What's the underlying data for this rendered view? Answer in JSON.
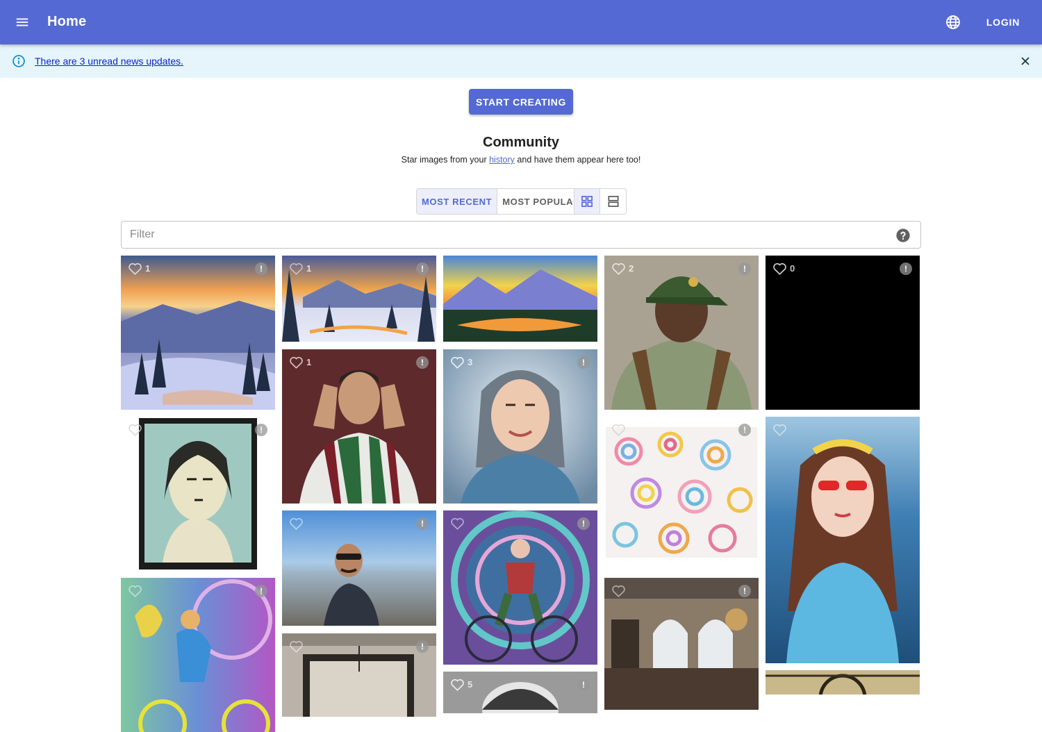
{
  "appbar": {
    "title": "Home",
    "login_label": "LOGIN"
  },
  "banner": {
    "message": "There are 3 unread news updates."
  },
  "hero": {
    "start_label": "START CREATING"
  },
  "community": {
    "title": "Community",
    "subtitle_before": "Star images from your ",
    "subtitle_link": "history",
    "subtitle_after": " and have them appear here too!"
  },
  "sort": {
    "recent_label": "MOST RECENT",
    "popular_label": "MOST POPULAR"
  },
  "filter": {
    "placeholder": "Filter"
  },
  "tiles": [
    {
      "name": "tile-winter-sunset",
      "likes": "1"
    },
    {
      "name": "tile-snowy-forest",
      "likes": "1"
    },
    {
      "name": "tile-mountain-lake",
      "likes": ""
    },
    {
      "name": "tile-man-green-cap",
      "likes": "2"
    },
    {
      "name": "tile-black-image",
      "likes": "0"
    },
    {
      "name": "tile-soccer-player",
      "likes": "1"
    },
    {
      "name": "tile-nurse-portrait",
      "likes": "3"
    },
    {
      "name": "tile-woodcut-woman",
      "likes": ""
    },
    {
      "name": "tile-swirl-pattern",
      "likes": ""
    },
    {
      "name": "tile-woman-in-water",
      "likes": ""
    },
    {
      "name": "tile-beach-selfie",
      "likes": ""
    },
    {
      "name": "tile-psychedelic-cyclist",
      "likes": ""
    },
    {
      "name": "tile-loft-interior",
      "likes": ""
    },
    {
      "name": "tile-cyclist-colorful",
      "likes": ""
    },
    {
      "name": "tile-concrete-interior",
      "likes": ""
    },
    {
      "name": "tile-grayscale-portrait",
      "likes": "5"
    },
    {
      "name": "tile-ornate-pattern",
      "likes": ""
    }
  ]
}
